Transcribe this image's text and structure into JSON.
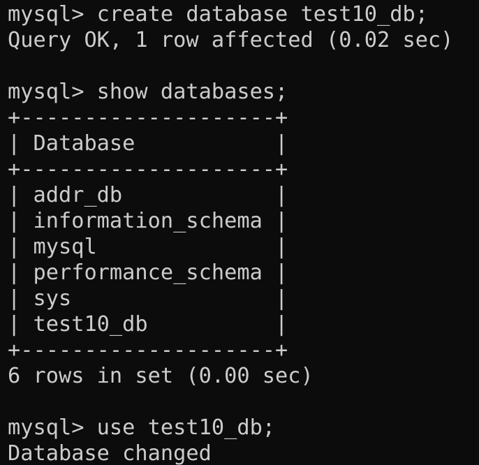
{
  "terminal": {
    "lines": [
      "mysql> create database test10_db;",
      "Query OK, 1 row affected (0.02 sec)",
      "",
      "mysql> show databases;",
      "+--------------------+",
      "| Database           |",
      "+--------------------+",
      "| addr_db            |",
      "| information_schema |",
      "| mysql              |",
      "| performance_schema |",
      "| sys                |",
      "| test10_db          |",
      "+--------------------+",
      "6 rows in set (0.00 sec)",
      "",
      "mysql> use test10_db;",
      "Database changed"
    ]
  },
  "colors": {
    "background": "#0c0c0c",
    "foreground": "#cccccc"
  }
}
